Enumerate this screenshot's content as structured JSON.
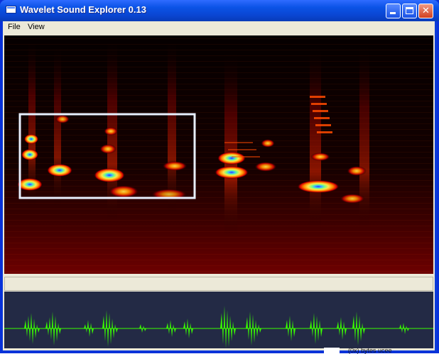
{
  "window": {
    "title": "Wavelet Sound Explorer 0.13",
    "controls": {
      "minimize_icon": "minimize-icon",
      "maximize_icon": "maximize-icon",
      "close_icon": "close-icon"
    }
  },
  "menubar": {
    "items": [
      {
        "label": "File"
      },
      {
        "label": "View"
      }
    ]
  },
  "views": {
    "spectrogram": {
      "colormap": [
        "#000000",
        "#3a0000",
        "#a00000",
        "#ff2a00",
        "#ff8a00",
        "#ffe34a",
        "#7dff7d",
        "#3fb7ff",
        "#2d3bff"
      ]
    },
    "waveform": {
      "color": "#39ff00",
      "background": "#232a45"
    },
    "selection": {
      "color": "#e8f0ff"
    }
  },
  "desktop": {
    "corner_text": "(0x) bytes ucee"
  }
}
